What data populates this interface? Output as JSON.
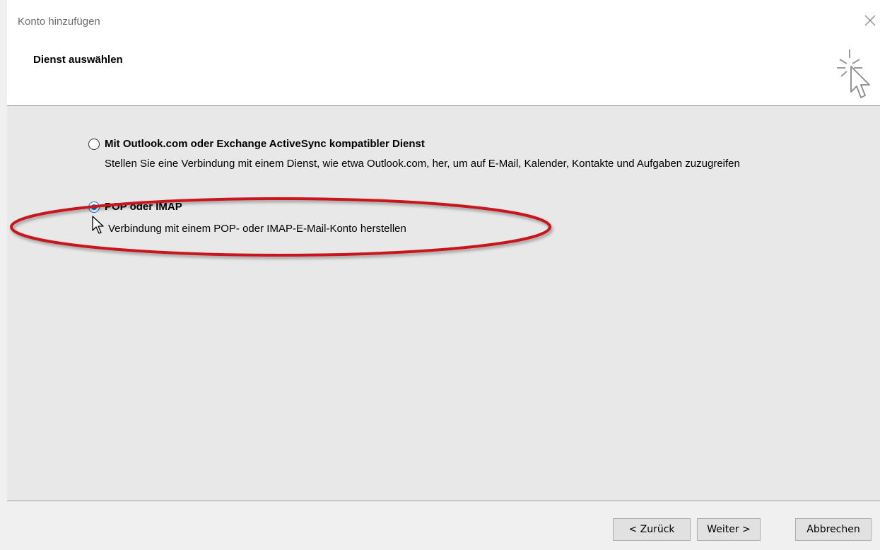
{
  "window": {
    "title": "Konto hinzufügen",
    "close_icon": "close-icon"
  },
  "header": {
    "section_title": "Dienst auswählen",
    "wizard_icon": "click-cursor-icon"
  },
  "options": [
    {
      "label": "Mit Outlook.com oder Exchange ActiveSync kompatibler Dienst",
      "description": "Stellen Sie eine Verbindung mit einem Dienst, wie etwa Outlook.com, her, um auf E-Mail, Kalender, Kontakte und Aufgaben zuzugreifen",
      "selected": false
    },
    {
      "label": "POP oder IMAP",
      "description": "Verbindung mit einem POP- oder IMAP-E-Mail-Konto herstellen",
      "selected": true
    }
  ],
  "annotation": {
    "color": "#c8141b",
    "shape": "ellipse-highlight"
  },
  "footer": {
    "back_label": "< Zurück",
    "next_label": "Weiter >",
    "cancel_label": "Abbrechen"
  },
  "colors": {
    "accent": "#0078d7",
    "header_bg": "#ffffff",
    "content_bg": "#e8e8e8"
  }
}
